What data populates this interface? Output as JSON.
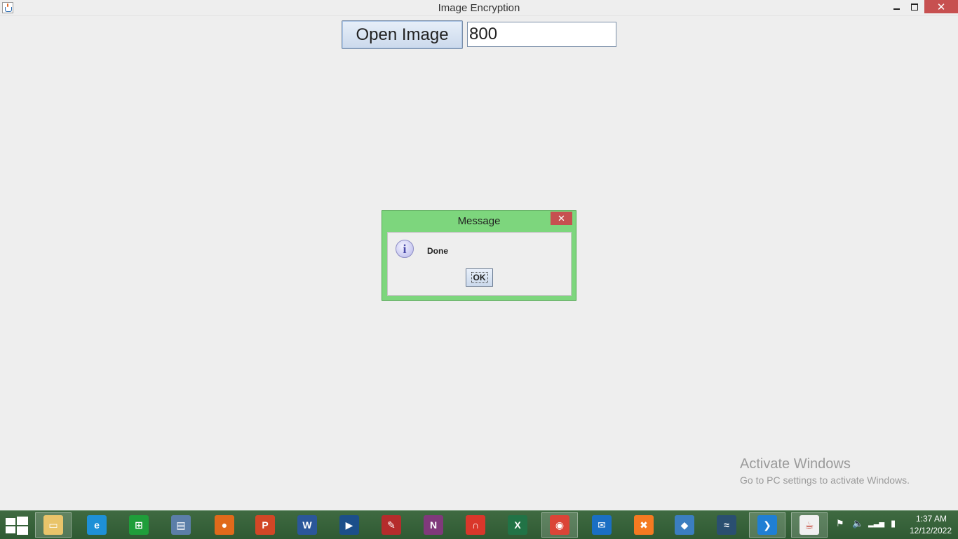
{
  "window": {
    "title": "Image Encryption",
    "minimize_glyph": "",
    "maximize_glyph": "",
    "close_glyph": "✕"
  },
  "main": {
    "open_button_label": "Open Image",
    "value_field": "800"
  },
  "dialog": {
    "title": "Message",
    "close_glyph": "✕",
    "info_glyph": "i",
    "message": "Done",
    "ok_label": "OK"
  },
  "watermark": {
    "title": "Activate Windows",
    "subtitle": "Go to PC settings to activate Windows."
  },
  "taskbar": {
    "icons": [
      {
        "name": "file-explorer-icon",
        "color": "#e9c46a",
        "glyph": "▭"
      },
      {
        "name": "internet-explorer-icon",
        "color": "#1e90d6",
        "glyph": "e"
      },
      {
        "name": "windows-store-icon",
        "color": "#1f9e3a",
        "glyph": "⊞"
      },
      {
        "name": "document-viewer-icon",
        "color": "#5b7ea8",
        "glyph": "▤"
      },
      {
        "name": "firefox-icon",
        "color": "#e06a1b",
        "glyph": "●"
      },
      {
        "name": "powerpoint-icon",
        "color": "#d24726",
        "glyph": "P"
      },
      {
        "name": "word-icon",
        "color": "#2b579a",
        "glyph": "W"
      },
      {
        "name": "media-player-icon",
        "color": "#1c4f8a",
        "glyph": "▶"
      },
      {
        "name": "pdf-reader-icon",
        "color": "#b52c2c",
        "glyph": "✎"
      },
      {
        "name": "onenote-icon",
        "color": "#80397b",
        "glyph": "N"
      },
      {
        "name": "headphones-app-icon",
        "color": "#d9372b",
        "glyph": "∩"
      },
      {
        "name": "excel-icon",
        "color": "#217346",
        "glyph": "X"
      },
      {
        "name": "chrome-icon",
        "color": "#db4437",
        "glyph": "◉"
      },
      {
        "name": "mail-icon",
        "color": "#1a6fc4",
        "glyph": "✉"
      },
      {
        "name": "xampp-icon",
        "color": "#f57a21",
        "glyph": "✖"
      },
      {
        "name": "virtualbox-icon",
        "color": "#3b7ec0",
        "glyph": "◆"
      },
      {
        "name": "mysql-workbench-icon",
        "color": "#2a4f70",
        "glyph": "≈"
      },
      {
        "name": "vscode-icon",
        "color": "#1f7fd4",
        "glyph": "❯"
      },
      {
        "name": "java-app-icon",
        "color": "#f0f0f0",
        "glyph": "☕"
      }
    ],
    "tray": {
      "flag_glyph": "⚑",
      "volume_glyph": "🔈",
      "signal_glyph": "▂▃▅",
      "battery_glyph": "▮"
    },
    "clock_time": "1:37 AM",
    "clock_date": "12/12/2022"
  }
}
